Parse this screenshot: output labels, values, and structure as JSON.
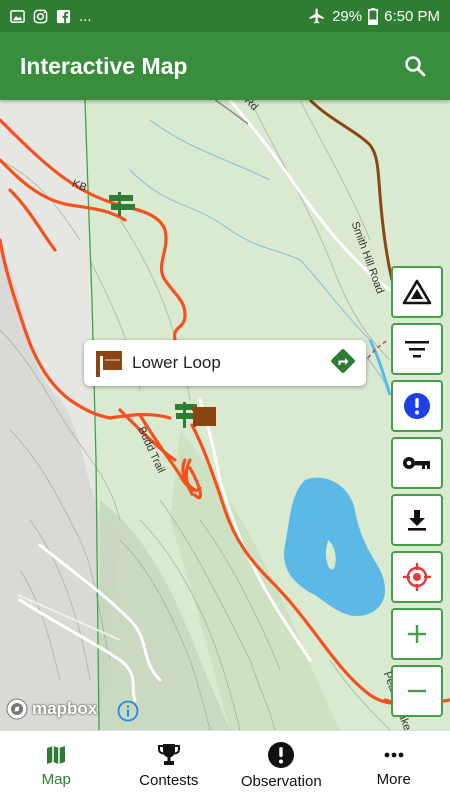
{
  "status_bar": {
    "notif_more": "...",
    "battery": "29%",
    "time": "6:50 PM"
  },
  "app_bar": {
    "title": "Interactive Map",
    "search_icon": "search-icon"
  },
  "map": {
    "road_labels": {
      "kb": "KB",
      "rd": "Rd",
      "smith_hill": "Smith Hill Road",
      "budd_trail": "Budd Trail",
      "peanut_lake": "Peanut Lake"
    },
    "popup": {
      "icon": "trail-sign-icon",
      "label": "Lower Loop",
      "directions_icon": "directions-icon"
    },
    "controls": [
      {
        "name": "terrain-layer-button",
        "icon": "triangle-terrain-icon"
      },
      {
        "name": "filter-button",
        "icon": "filter-icon"
      },
      {
        "name": "alert-button",
        "icon": "exclamation-icon"
      },
      {
        "name": "access-key-button",
        "icon": "key-icon"
      },
      {
        "name": "download-button",
        "icon": "download-icon"
      },
      {
        "name": "locate-button",
        "icon": "crosshair-icon"
      },
      {
        "name": "zoom-in-button",
        "icon": "plus-icon"
      },
      {
        "name": "zoom-out-button",
        "icon": "minus-icon"
      }
    ],
    "attribution": "mapbox"
  },
  "bottom_nav": {
    "items": [
      {
        "label": "Map",
        "icon": "map-icon",
        "active": true
      },
      {
        "label": "Contests",
        "icon": "trophy-icon",
        "active": false
      },
      {
        "label": "Observation",
        "icon": "exclamation-circle-icon",
        "active": false
      },
      {
        "label": "More",
        "icon": "more-dots-icon",
        "active": false
      }
    ]
  },
  "colors": {
    "primary": "#388e3c",
    "status_bar": "#2e7d32",
    "trail": "#f4511e",
    "water": "#5cb8e6",
    "alert_blue": "#1e40e6",
    "locate_red": "#e53935"
  }
}
